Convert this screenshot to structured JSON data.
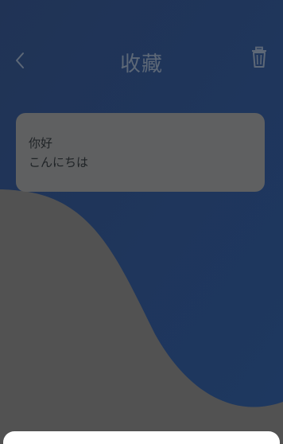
{
  "header": {
    "title": "收藏",
    "back_icon": "chevron-left-icon",
    "trash_icon": "trash-icon"
  },
  "favorites": [
    {
      "chinese": "你好",
      "japanese": "こんにちは"
    }
  ],
  "colors": {
    "background_gray": "#5a5a5a",
    "wave_blue": "#223b63",
    "header_icon": "#5d6877",
    "card_bg": "#5f6061",
    "card_text": "#1f2326",
    "bottom_sheet": "#ffffff"
  }
}
